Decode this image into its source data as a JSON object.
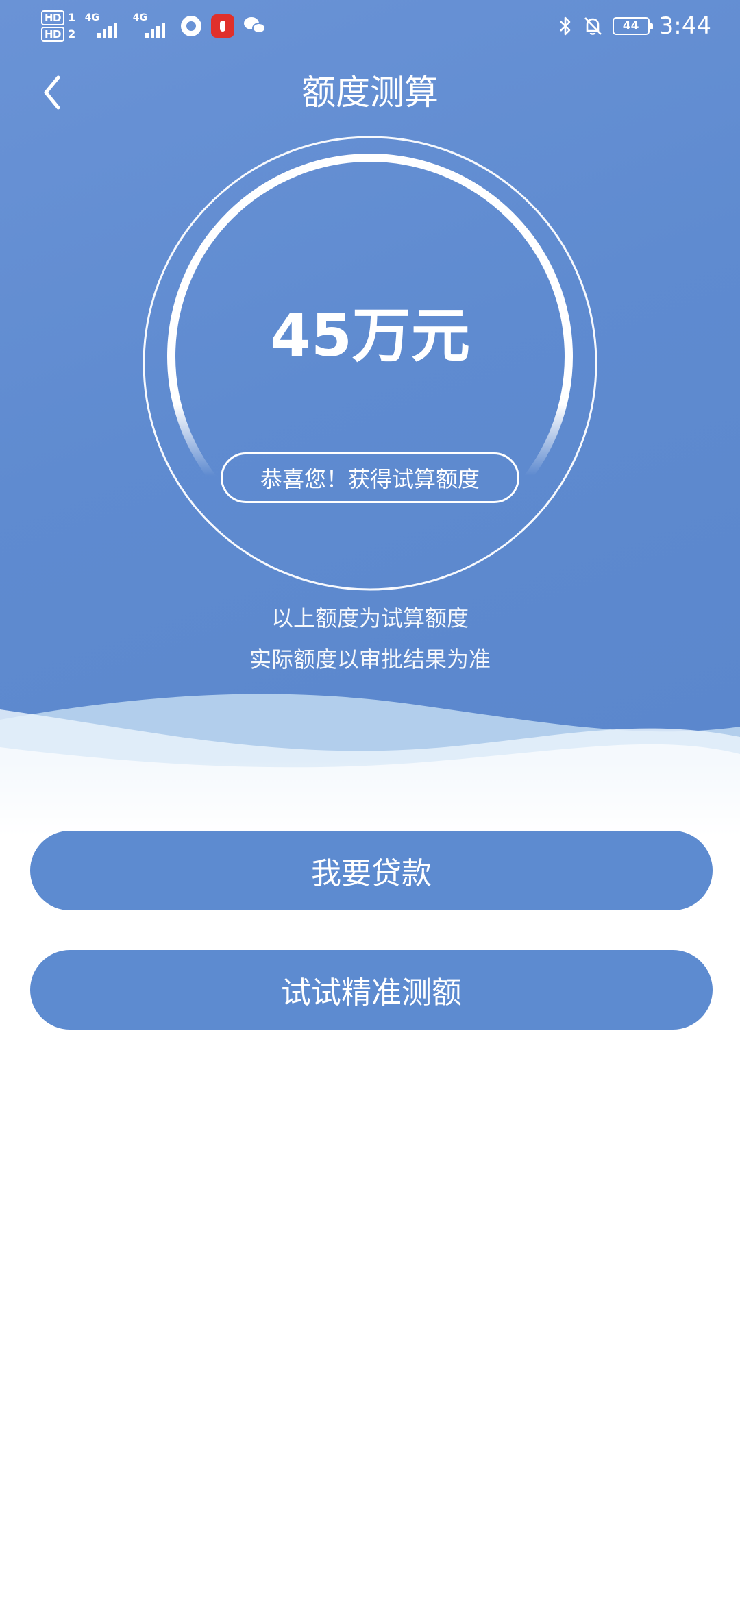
{
  "status_bar": {
    "hd1": "HD",
    "hd1_sub": "1",
    "hd2": "HD",
    "hd2_sub": "2",
    "network1": "4G",
    "network2": "4G",
    "battery": "44",
    "time": "3:44"
  },
  "header": {
    "title": "额度测算"
  },
  "result": {
    "amount": "45万元",
    "congrats": "恭喜您！获得试算额度"
  },
  "notes": {
    "line1": "以上额度为试算额度",
    "line2": "实际额度以审批结果为准"
  },
  "buttons": {
    "loan": "我要贷款",
    "precise": "试试精准测额"
  },
  "colors": {
    "primary_blue": "#5d8bd0",
    "background": "#ffffff",
    "record_red": "#e0302b"
  },
  "icons": {
    "back": "chevron-left-icon",
    "bluetooth": "bluetooth-icon",
    "mute": "bell-off-icon",
    "mic": "microphone-icon",
    "wechat": "wechat-icon"
  }
}
